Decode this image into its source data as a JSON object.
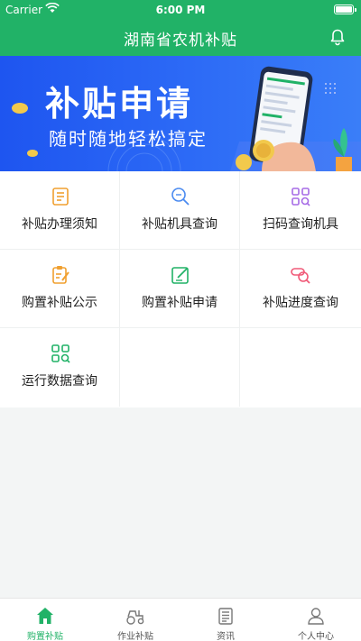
{
  "status_bar": {
    "carrier": "Carrier",
    "time": "6:00 PM"
  },
  "header": {
    "title": "湖南省农机补贴"
  },
  "banner": {
    "title": "补贴申请",
    "subtitle": "随时随地轻松搞定"
  },
  "menu": [
    {
      "label": "补贴办理须知",
      "icon": "document-list-icon",
      "color": "#f0a030"
    },
    {
      "label": "补贴机具查询",
      "icon": "subsidy-search-icon",
      "color": "#4a8af0"
    },
    {
      "label": "扫码查询机具",
      "icon": "grid-search-icon",
      "color": "#a66be6"
    },
    {
      "label": "购置补贴公示",
      "icon": "clipboard-edit-icon",
      "color": "#f0a030"
    },
    {
      "label": "购置补贴申请",
      "icon": "edit-square-icon",
      "color": "#21b267"
    },
    {
      "label": "补贴进度查询",
      "icon": "progress-search-icon",
      "color": "#f05a78"
    },
    {
      "label": "运行数据查询",
      "icon": "data-grid-search-icon",
      "color": "#21b267"
    }
  ],
  "tabs": [
    {
      "label": "购置补贴",
      "icon": "home-icon",
      "active": true
    },
    {
      "label": "作业补贴",
      "icon": "tractor-icon",
      "active": false
    },
    {
      "label": "资讯",
      "icon": "news-icon",
      "active": false
    },
    {
      "label": "个人中心",
      "icon": "person-icon",
      "active": false
    }
  ],
  "colors": {
    "primary": "#21b267",
    "banner_blue": "#2d6bf6"
  }
}
